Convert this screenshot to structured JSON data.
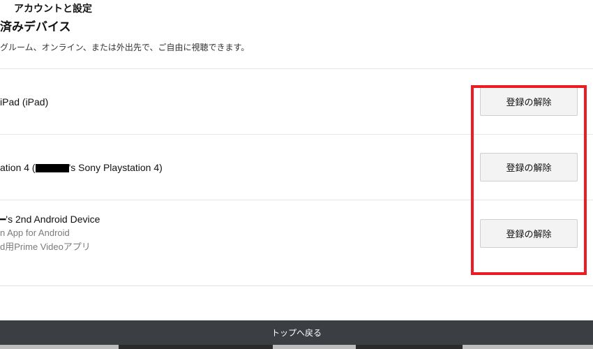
{
  "header": {
    "title_small": "アカウントと設定",
    "subtitle": "済みデバイス",
    "description": "グルーム、オンライン、または外出先で、ご自由に視聴できます。"
  },
  "deregister_label": "登録の解除",
  "devices": [
    {
      "name_prefix": "iPad (iPad)",
      "name_suffix": "",
      "sub1": "",
      "sub2": ""
    },
    {
      "name_prefix": "ation 4 (",
      "name_suffix": "'s Sony Playstation 4)",
      "sub1": "",
      "sub2": ""
    },
    {
      "name_prefix": "━'s 2nd Android Device",
      "name_suffix": "",
      "sub1": "n App for Android",
      "sub2": "d用Prime Videoアプリ"
    }
  ],
  "footer": {
    "back_to_top": "トップへ戻る"
  }
}
